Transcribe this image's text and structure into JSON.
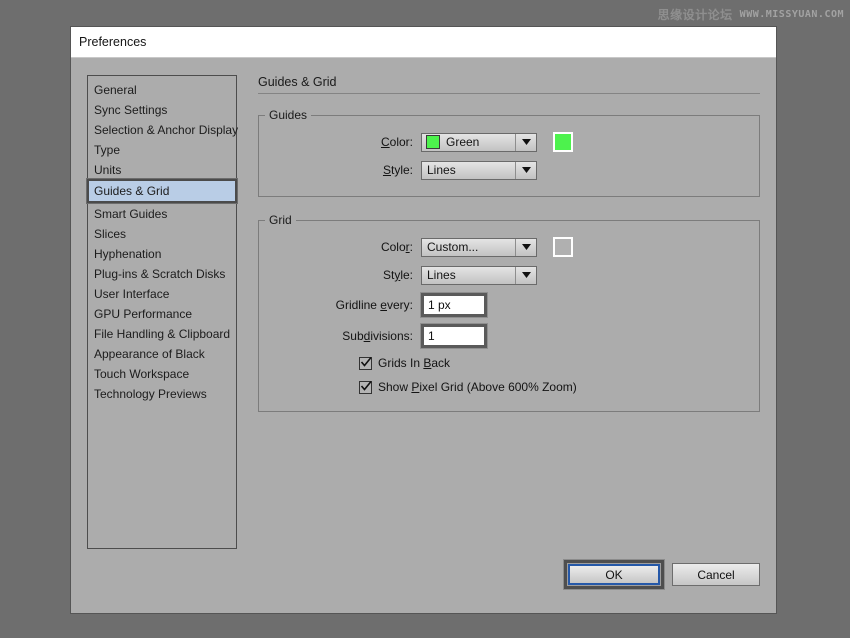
{
  "watermark": {
    "cn": "思缘设计论坛",
    "url": "WWW.MISSYUAN.COM"
  },
  "dialog": {
    "title": "Preferences"
  },
  "sidebar": {
    "items": [
      {
        "label": "General",
        "selected": false
      },
      {
        "label": "Sync Settings",
        "selected": false
      },
      {
        "label": "Selection & Anchor Display",
        "selected": false
      },
      {
        "label": "Type",
        "selected": false
      },
      {
        "label": "Units",
        "selected": false
      },
      {
        "label": "Guides & Grid",
        "selected": true
      },
      {
        "label": "Smart Guides",
        "selected": false
      },
      {
        "label": "Slices",
        "selected": false
      },
      {
        "label": "Hyphenation",
        "selected": false
      },
      {
        "label": "Plug-ins & Scratch Disks",
        "selected": false
      },
      {
        "label": "User Interface",
        "selected": false
      },
      {
        "label": "GPU Performance",
        "selected": false
      },
      {
        "label": "File Handling & Clipboard",
        "selected": false
      },
      {
        "label": "Appearance of Black",
        "selected": false
      },
      {
        "label": "Touch Workspace",
        "selected": false
      },
      {
        "label": "Technology Previews",
        "selected": false
      }
    ]
  },
  "pane": {
    "header": "Guides & Grid",
    "guides": {
      "legend": "Guides",
      "color_label_pre": "",
      "color_label_accel": "C",
      "color_label_post": "olor:",
      "color_value": "Green",
      "color_hex": "#4df24d",
      "swatch_hex": "#4df24d",
      "style_label_accel": "S",
      "style_label_post": "tyle:",
      "style_value": "Lines"
    },
    "grid": {
      "legend": "Grid",
      "color_label_pre": "Colo",
      "color_label_accel": "r",
      "color_label_post": ":",
      "color_value": "Custom...",
      "swatch_hex": "#b0b0b0",
      "style_label_pre": "St",
      "style_label_accel": "y",
      "style_label_post": "le:",
      "style_value": "Lines",
      "gridline_label_pre": "Gridline ",
      "gridline_label_accel": "e",
      "gridline_label_post": "very:",
      "gridline_value": "1 px",
      "subdiv_label_pre": "Sub",
      "subdiv_label_accel": "d",
      "subdiv_label_post": "ivisions:",
      "subdiv_value": "1",
      "grids_in_back": {
        "label_pre": "Grids In ",
        "label_accel": "B",
        "label_post": "ack",
        "checked": true
      },
      "show_pixel_grid": {
        "label_pre": "Show ",
        "label_accel": "P",
        "label_post": "ixel Grid (Above 600% Zoom)",
        "checked": true
      }
    }
  },
  "footer": {
    "ok_label": "OK",
    "cancel_label": "Cancel"
  },
  "colors": {
    "desktop_bg": "#6e6e6e",
    "dialog_bg": "#acacac",
    "titlebar_bg": "#ffffff",
    "selection_bg": "#b9cde6",
    "focus_blue": "#2558a8"
  }
}
